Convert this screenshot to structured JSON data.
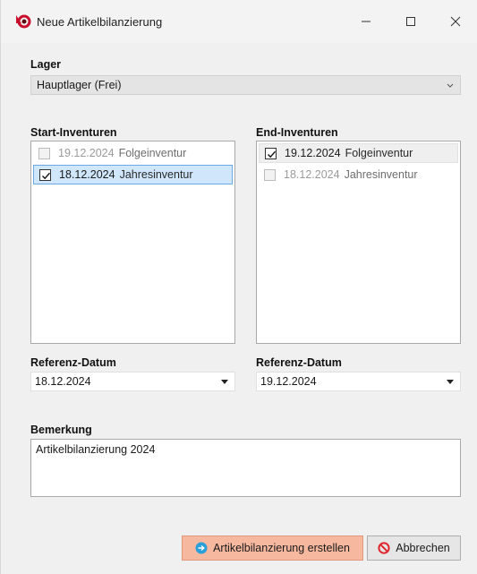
{
  "window": {
    "title": "Neue Artikelbilanzierung",
    "controls": {
      "minimize": "minimize",
      "maximize": "maximize",
      "close": "close"
    }
  },
  "lager": {
    "label": "Lager",
    "value": "Hauptlager (Frei)"
  },
  "start_inventuren": {
    "label": "Start-Inventuren",
    "items": [
      {
        "date": "19.12.2024",
        "name": "Folgeinventur",
        "checked": false,
        "enabled": false
      },
      {
        "date": "18.12.2024",
        "name": "Jahresinventur",
        "checked": true,
        "enabled": true
      }
    ]
  },
  "end_inventuren": {
    "label": "End-Inventuren",
    "items": [
      {
        "date": "19.12.2024",
        "name": "Folgeinventur",
        "checked": true,
        "enabled": true
      },
      {
        "date": "18.12.2024",
        "name": "Jahresinventur",
        "checked": false,
        "enabled": false
      }
    ]
  },
  "referenz_start": {
    "label": "Referenz-Datum",
    "value": "18.12.2024"
  },
  "referenz_end": {
    "label": "Referenz-Datum",
    "value": "19.12.2024"
  },
  "bemerkung": {
    "label": "Bemerkung",
    "value": "Artikelbilanzierung 2024"
  },
  "buttons": {
    "create": "Artikelbilanzierung erstellen",
    "cancel": "Abbrechen"
  },
  "colors": {
    "primary_button": "#f6b89f",
    "selection_blue": "#cfe6fb",
    "cancel_icon": "#e0262b",
    "create_icon": "#2a9fd8"
  },
  "icons": {
    "app": "app-logo-icon",
    "create": "arrow-right-circle-icon",
    "cancel": "no-entry-icon",
    "dropdown": "chevron-down-icon"
  }
}
